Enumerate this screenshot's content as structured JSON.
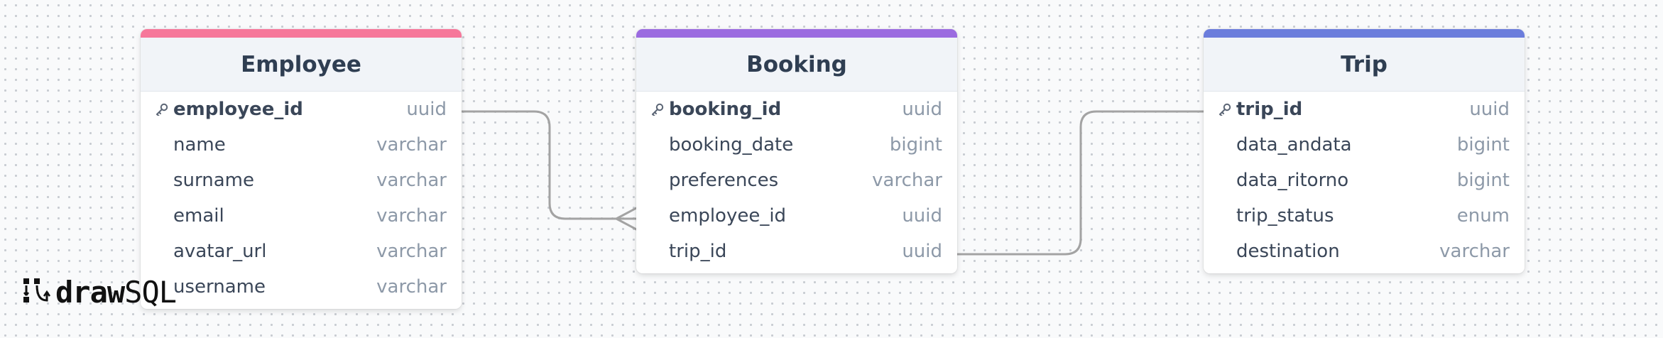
{
  "tables": [
    {
      "name": "Employee",
      "accent": "#f6779a",
      "columns": [
        {
          "name": "employee_id",
          "type": "uuid",
          "pk": true
        },
        {
          "name": "name",
          "type": "varchar",
          "pk": false
        },
        {
          "name": "surname",
          "type": "varchar",
          "pk": false
        },
        {
          "name": "email",
          "type": "varchar",
          "pk": false
        },
        {
          "name": "avatar_url",
          "type": "varchar",
          "pk": false
        },
        {
          "name": "username",
          "type": "varchar",
          "pk": false
        }
      ]
    },
    {
      "name": "Booking",
      "accent": "#9b6be0",
      "columns": [
        {
          "name": "booking_id",
          "type": "uuid",
          "pk": true
        },
        {
          "name": "booking_date",
          "type": "bigint",
          "pk": false
        },
        {
          "name": "preferences",
          "type": "varchar",
          "pk": false
        },
        {
          "name": "employee_id",
          "type": "uuid",
          "pk": false
        },
        {
          "name": "trip_id",
          "type": "uuid",
          "pk": false
        }
      ]
    },
    {
      "name": "Trip",
      "accent": "#6b7ddc",
      "columns": [
        {
          "name": "trip_id",
          "type": "uuid",
          "pk": true
        },
        {
          "name": "data_andata",
          "type": "bigint",
          "pk": false
        },
        {
          "name": "data_ritorno",
          "type": "bigint",
          "pk": false
        },
        {
          "name": "trip_status",
          "type": "enum",
          "pk": false
        },
        {
          "name": "destination",
          "type": "varchar",
          "pk": false
        }
      ]
    }
  ],
  "relations": [
    {
      "from": "Employee.employee_id",
      "to": "Booking.employee_id",
      "cardinality": "one-to-many"
    },
    {
      "from": "Booking.trip_id",
      "to": "Trip.trip_id",
      "cardinality": "one-to-one"
    }
  ],
  "colors": {
    "connector": "#a3a3a3"
  },
  "logo": {
    "part1": "draw",
    "part2": "SQL",
    "icon": "drawsql-logo-icon"
  },
  "icons": {
    "primary_key": "key-icon"
  }
}
